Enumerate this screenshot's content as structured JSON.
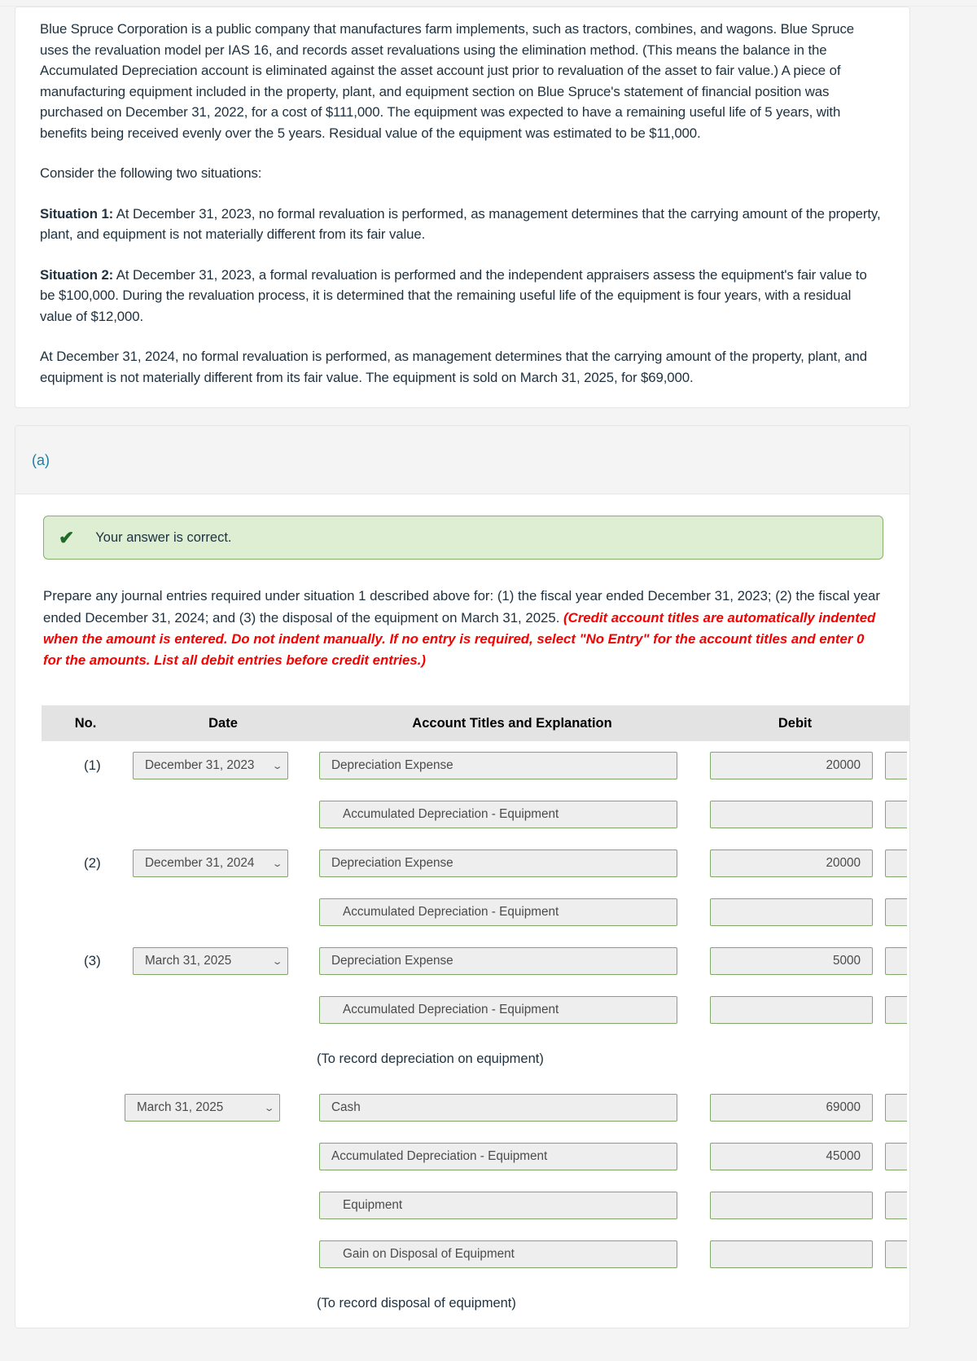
{
  "problem": {
    "paragraphs": [
      "Blue Spruce Corporation is a public company that manufactures farm implements, such as tractors, combines, and wagons. Blue Spruce uses the revaluation model per IAS 16, and records asset revaluations using the elimination method. (This means the balance in the Accumulated Depreciation account is eliminated against the asset account just prior to revaluation of the asset to fair value.) A piece of manufacturing equipment included in the property, plant, and equipment section on Blue Spruce's statement of financial position was purchased on December 31, 2022, for a cost of $111,000. The equipment was expected to have a remaining useful life of 5 years, with benefits being received evenly over the 5 years. Residual value of the equipment was estimated to be $11,000.",
      "Consider the following two situations:"
    ],
    "situation1_label": "Situation 1:",
    "situation1_text": " At December 31, 2023, no formal revaluation is performed, as management determines that the carrying amount of the property, plant, and equipment is not materially different from its fair value.",
    "situation2_label": "Situation 2:",
    "situation2_text": " At December 31, 2023, a formal revaluation is performed and the independent appraisers assess the equipment's fair value to be $100,000. During the revaluation process, it is determined that the remaining useful life of the equipment is four years, with a residual value of $12,000.",
    "closing": "At December 31, 2024, no formal revaluation is performed, as management determines that the carrying amount of the property, plant, and equipment is not materially different from its fair value. The equipment is sold on March 31, 2025, for $69,000."
  },
  "part": {
    "label": "(a)",
    "alert": {
      "icon": "check-icon",
      "message": "Your answer is correct."
    },
    "instruction_plain": "Prepare any journal entries required under situation 1 described above for: (1) the fiscal year ended December 31, 2023; (2) the fiscal year ended December 31, 2024; and (3) the disposal of the equipment on March 31, 2025. ",
    "instruction_red": "(Credit account titles are automatically indented when the amount is entered. Do not indent manually. If no entry is required, select \"No Entry\" for the account titles and enter 0 for the amounts. List all debit entries before credit entries.)"
  },
  "table": {
    "headers": {
      "no": "No.",
      "date": "Date",
      "account": "Account Titles and Explanation",
      "debit": "Debit",
      "credit": ""
    },
    "rows": [
      {
        "kind": "entry",
        "no": "(1)",
        "date": "December 31, 2023",
        "account": "Depreciation Expense",
        "indent": false,
        "debit": "20000",
        "credit": ""
      },
      {
        "kind": "entry",
        "no": "",
        "date": "",
        "account": "Accumulated Depreciation - Equipment",
        "indent": true,
        "debit": "",
        "credit": ""
      },
      {
        "kind": "entry",
        "no": "(2)",
        "date": "December 31, 2024",
        "account": "Depreciation Expense",
        "indent": false,
        "debit": "20000",
        "credit": ""
      },
      {
        "kind": "entry",
        "no": "",
        "date": "",
        "account": "Accumulated Depreciation - Equipment",
        "indent": true,
        "debit": "",
        "credit": ""
      },
      {
        "kind": "entry",
        "no": "(3)",
        "date": "March 31, 2025",
        "account": "Depreciation Expense",
        "indent": false,
        "debit": "5000",
        "credit": ""
      },
      {
        "kind": "entry",
        "no": "",
        "date": "",
        "account": "Accumulated Depreciation - Equipment",
        "indent": true,
        "debit": "",
        "credit": ""
      },
      {
        "kind": "memo",
        "memo": "(To record depreciation on equipment)"
      },
      {
        "kind": "entry",
        "no": "",
        "date": "March 31, 2025",
        "date_shift": true,
        "account": "Cash",
        "indent": false,
        "debit": "69000",
        "credit": ""
      },
      {
        "kind": "entry",
        "no": "",
        "date": "",
        "account": "Accumulated Depreciation - Equipment",
        "indent": false,
        "debit": "45000",
        "credit": ""
      },
      {
        "kind": "entry",
        "no": "",
        "date": "",
        "account": "Equipment",
        "indent": true,
        "debit": "",
        "credit": ""
      },
      {
        "kind": "entry",
        "no": "",
        "date": "",
        "account": "Gain on Disposal of Equipment",
        "indent": true,
        "debit": "",
        "credit": ""
      },
      {
        "kind": "memo",
        "memo": "(To record disposal of equipment)"
      }
    ]
  },
  "colors": {
    "accent_link": "#1f7ea1",
    "alert_bg": "#ddeed3",
    "alert_border": "#87b169",
    "field_border": "#7fa86a",
    "field_bg": "#eeeeee",
    "red_note": "#f60000",
    "header_band": "#e3e3e3"
  },
  "icons": {
    "check": "✔",
    "caret_down": "⌄"
  }
}
